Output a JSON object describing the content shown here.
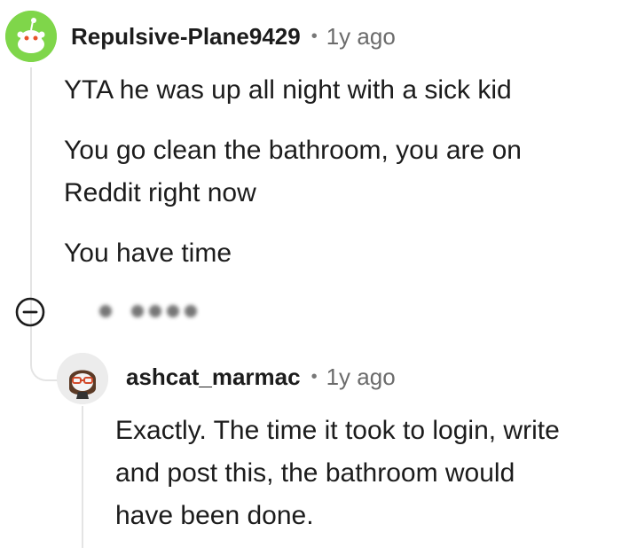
{
  "comment": {
    "username": "Repulsive-Plane9429",
    "separator": "•",
    "time": "1y ago",
    "paragraphs": [
      "YTA he was up all night with a sick kid",
      "You go clean the bathroom, you are on Reddit right now",
      "You have time"
    ],
    "avatar_icon": "reddit-snoo-avatar",
    "avatar_color": "#7fd64a"
  },
  "reply": {
    "username": "ashcat_marmac",
    "separator": "•",
    "time": "1y ago",
    "body": "Exactly. The time it took to login, write and post this, the bathroom would have been done.",
    "avatar_icon": "snoo-with-glasses-avatar"
  },
  "controls": {
    "collapse_icon": "collapse-minus-icon",
    "actions_icon": "blurred-action-icons"
  }
}
